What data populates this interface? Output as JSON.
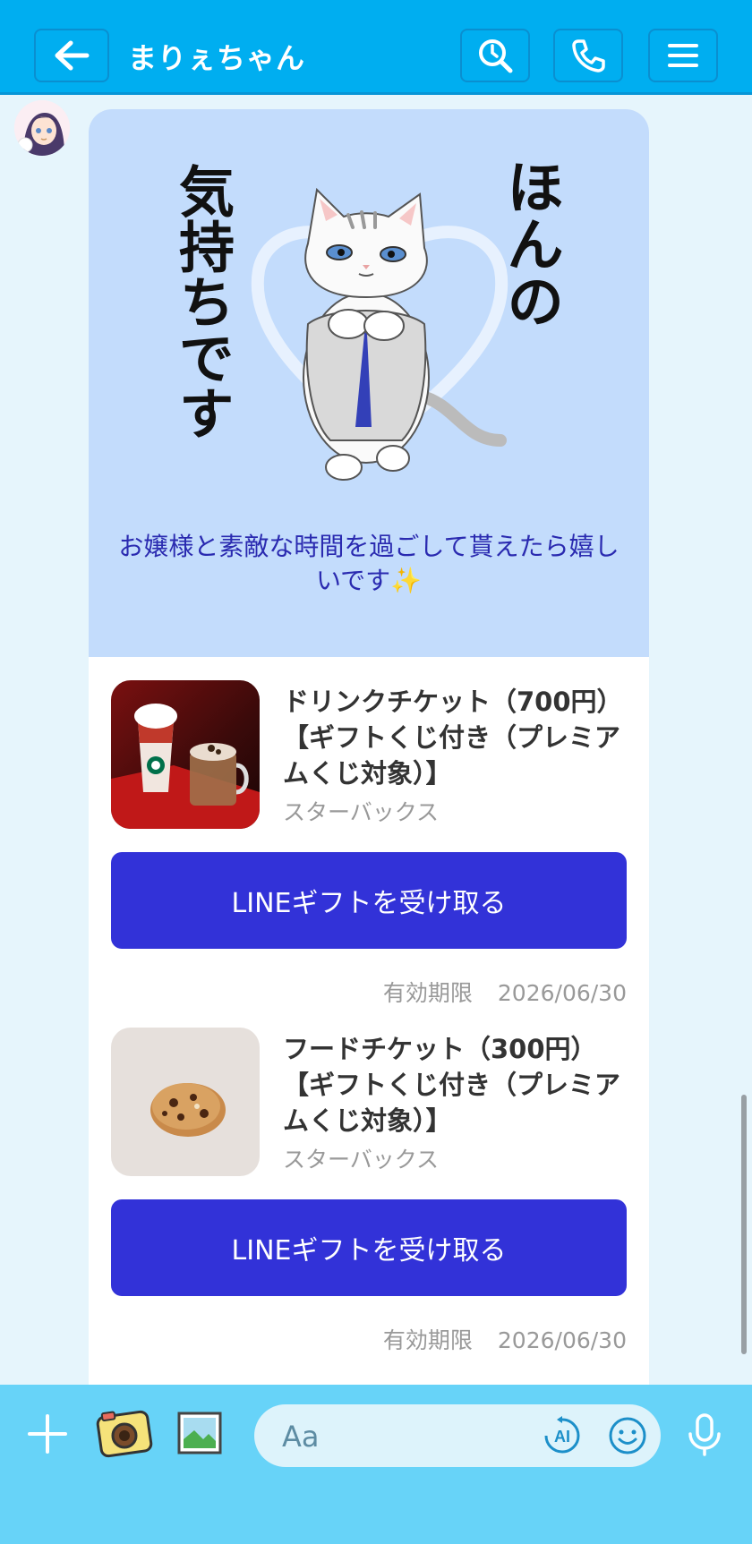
{
  "header": {
    "title": "まりぇちゃん",
    "back_icon": "arrow-left-icon",
    "search_icon": "search-icon",
    "call_icon": "phone-icon",
    "menu_icon": "menu-icon",
    "bg_color": "#00aef0"
  },
  "message": {
    "sticker_text_right": "ほんの",
    "sticker_text_left": "気持ちです",
    "text": "お嬢様と素敵な時間を過ごして貰えたら嬉しいです✨",
    "sticker_bg": "#c3dcfc"
  },
  "gifts": [
    {
      "name": "ドリンクチケット（700円）【ギフトくじ付き（プレミアムくじ対象）】",
      "brand": "スターバックス",
      "button_label": "LINEギフトを受け取る",
      "expiry_label": "有効期限",
      "expiry_date": "2026/06/30"
    },
    {
      "name": "フードチケット（300円）【ギフトくじ付き（プレミアムくじ対象）】",
      "brand": "スターバックス",
      "button_label": "LINEギフトを受け取る",
      "expiry_label": "有効期限",
      "expiry_date": "2026/06/30"
    }
  ],
  "input_bar": {
    "placeholder": "Aa",
    "ai_label": "AI",
    "plus_icon": "plus-icon",
    "camera_icon": "camera-icon",
    "image_icon": "image-icon",
    "emoji_icon": "emoji-icon",
    "mic_icon": "mic-icon"
  },
  "colors": {
    "accent": "#3232d8",
    "input_bar_bg": "#67d3f8"
  }
}
